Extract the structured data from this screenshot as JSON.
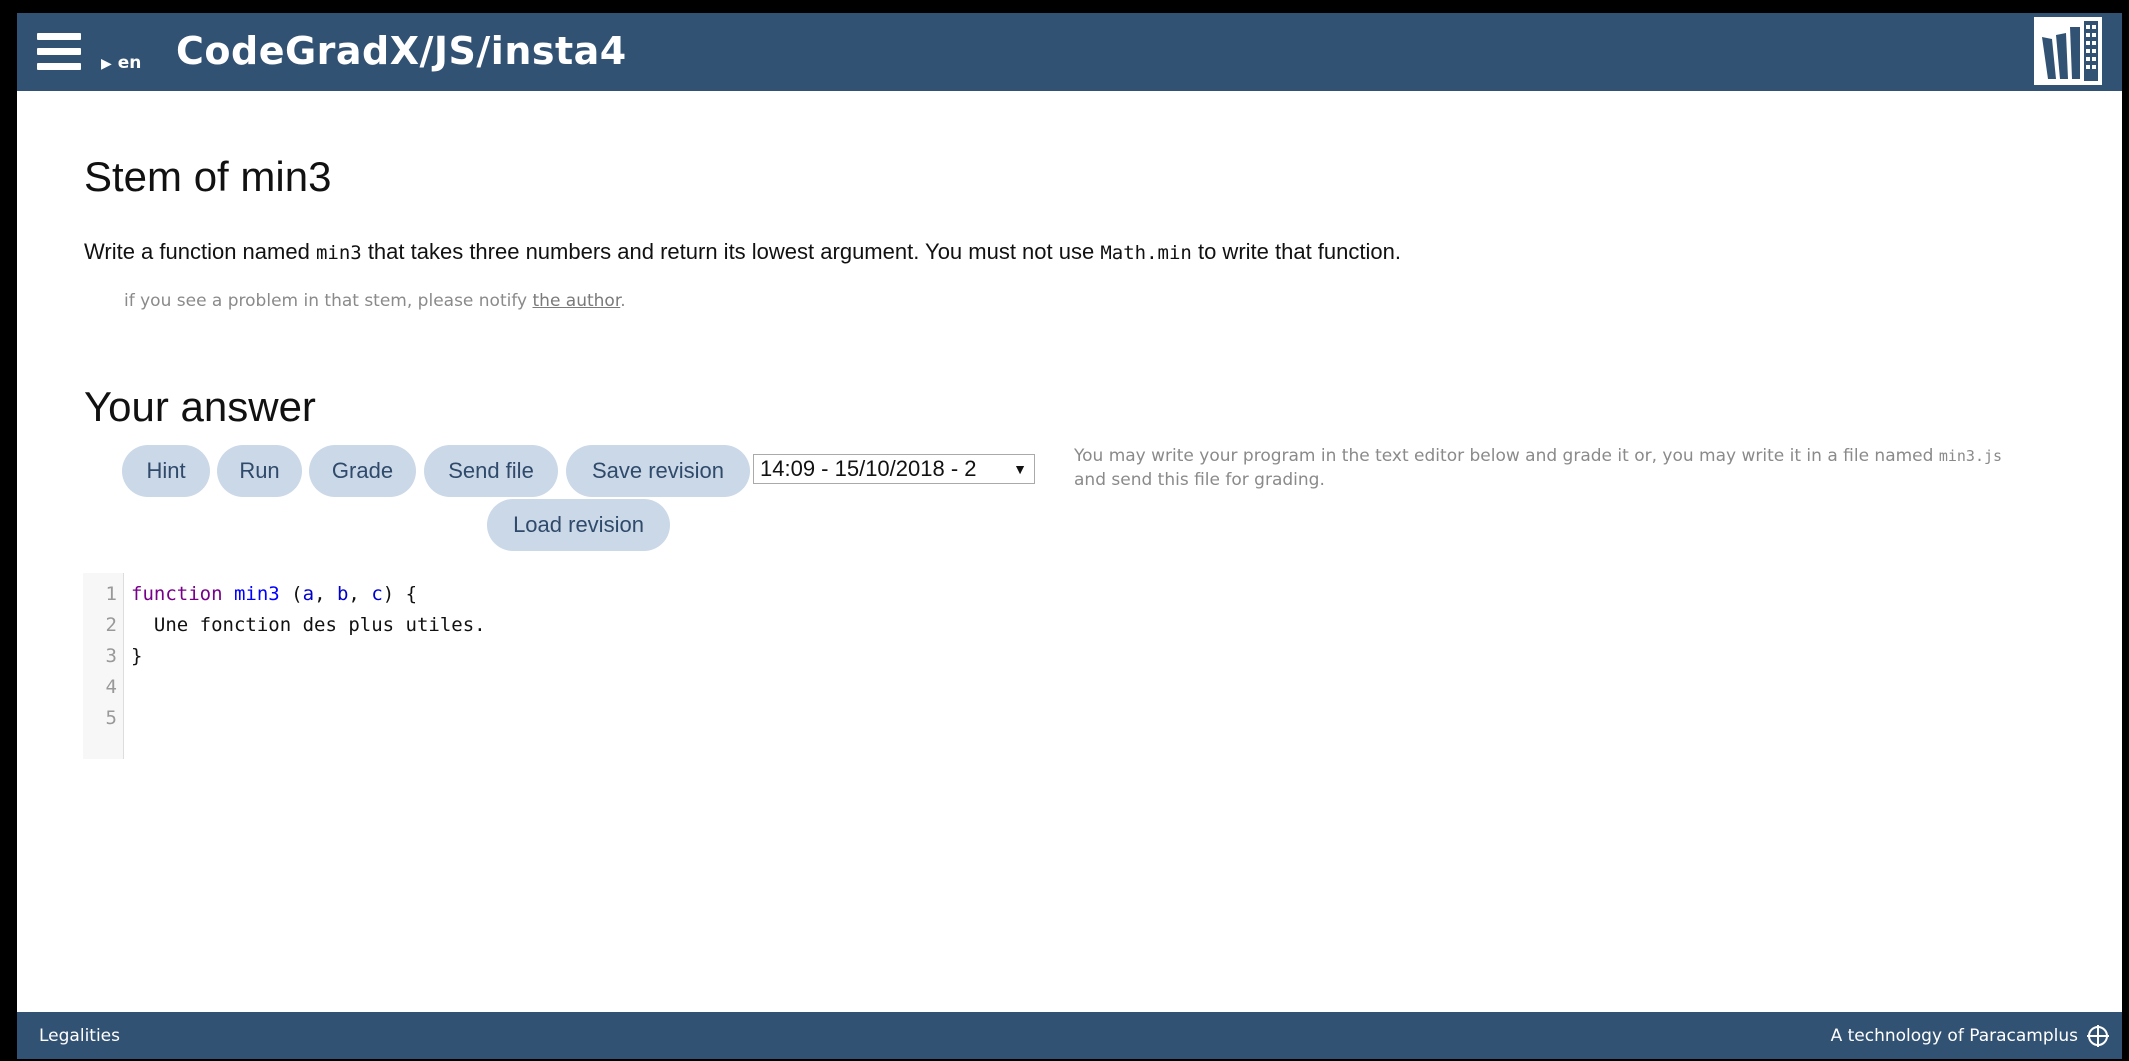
{
  "header": {
    "title": "CodeGradX/JS/insta4",
    "language": "en"
  },
  "stem": {
    "title": "Stem of min3",
    "text_part1": "Write a function named ",
    "code1": "min3",
    "text_part2": " that takes three numbers and return its lowest argument. You must not use ",
    "code2": "Math.min",
    "text_part3": " to write that function.",
    "notify_prefix": "if you see a problem in that stem, please notify ",
    "notify_link": "the author",
    "notify_suffix": "."
  },
  "answer": {
    "title": "Your answer",
    "buttons": {
      "hint": "Hint",
      "run": "Run",
      "grade": "Grade",
      "send_file": "Send file",
      "save_revision": "Save revision",
      "load_revision": "Load revision"
    },
    "revision_selected": "14:09 - 15/10/2018 - 2",
    "note_part1": "You may write your program in the text editor below and grade it or, you may write it in a file named ",
    "note_code": "min3.js",
    "note_part2": " and send this file for grading."
  },
  "editor": {
    "line_numbers": [
      "1",
      "2",
      "3",
      "4",
      "5"
    ],
    "line1": {
      "kw": "function",
      "name": "min3",
      "open": " (",
      "a": "a",
      "sep1": ", ",
      "b": "b",
      "sep2": ", ",
      "c": "c",
      "close": ") {"
    },
    "line2": "  Une fonction des plus utiles.",
    "line3": "}"
  },
  "footer": {
    "legalities": "Legalities",
    "tech": "A technology of Paracamplus"
  },
  "colors": {
    "bar": "#325274",
    "button_bg": "#cbd8e8"
  }
}
